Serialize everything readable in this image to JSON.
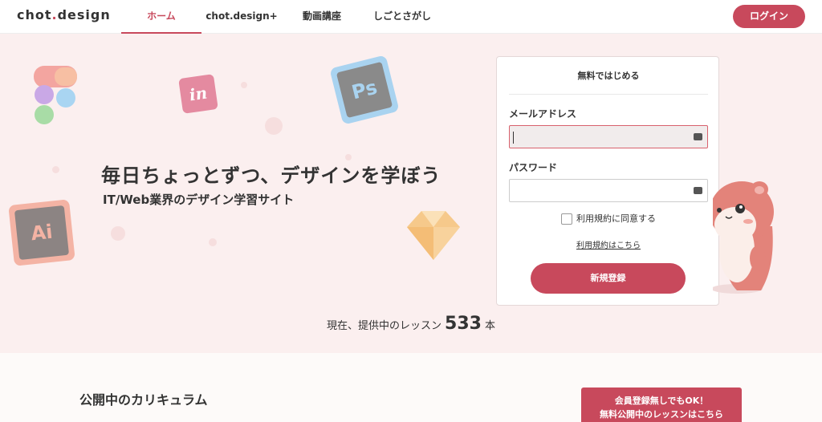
{
  "header": {
    "logo_left": "chot",
    "logo_dot": ".",
    "logo_right": "design",
    "nav": [
      {
        "label": "ホーム",
        "active": true
      },
      {
        "label": "chot.design+",
        "active": false
      },
      {
        "label": "動画講座",
        "active": false
      },
      {
        "label": "しごとさがし",
        "active": false
      }
    ],
    "login_label": "ログイン"
  },
  "hero": {
    "title": "毎日ちょっとずつ、デザインを学ぼう",
    "subtitle": "IT/Web業界のデザイン学習サイト",
    "lesson_prefix": "現在、提供中のレッスン",
    "lesson_count": "533",
    "lesson_suffix": "本",
    "icons": {
      "invision": "in",
      "photoshop": "Ps",
      "illustrator": "Ai"
    }
  },
  "signup": {
    "title": "無料ではじめる",
    "email_label": "メールアドレス",
    "email_value": "",
    "password_label": "パスワード",
    "password_value": "",
    "agree_label": "利用規約に同意する",
    "terms_link": "利用規約はこちら",
    "submit_label": "新規登録"
  },
  "bottom": {
    "curriculum_title": "公開中のカリキュラム",
    "free_line1": "会員登録無しでもOK！",
    "free_line2": "無料公開中のレッスンはこちら"
  },
  "colors": {
    "accent": "#c8495c",
    "hero_bg": "#fbefef"
  }
}
